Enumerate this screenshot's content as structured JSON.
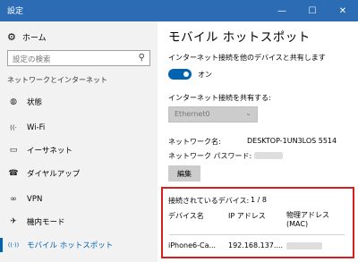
{
  "window": {
    "title": "設定",
    "controls": [
      "—",
      "☐",
      "✕"
    ]
  },
  "sidebar": {
    "home_label": "ホーム",
    "search_placeholder": "設定の検索",
    "section_title": "ネットワークとインターネット",
    "items": [
      {
        "label": "状態",
        "icon": "globe-icon",
        "glyph": "◍"
      },
      {
        "label": "Wi-Fi",
        "icon": "wifi-icon",
        "glyph": "((·"
      },
      {
        "label": "イーサネット",
        "icon": "ethernet-icon",
        "glyph": "▭"
      },
      {
        "label": "ダイヤルアップ",
        "icon": "dialup-icon",
        "glyph": "☎"
      },
      {
        "label": "VPN",
        "icon": "vpn-icon",
        "glyph": "∞"
      },
      {
        "label": "機内モード",
        "icon": "airplane-icon",
        "glyph": "✈"
      },
      {
        "label": "モバイル ホットスポット",
        "icon": "hotspot-icon",
        "glyph": "((·))"
      }
    ],
    "active_index": 6
  },
  "main": {
    "title": "モバイル ホットスポット",
    "share_label": "インターネット接続を他のデバイスと共有します",
    "toggle_state": "オン",
    "share_from_label": "インターネット接続を共有する:",
    "share_from_value": "Ethernet0",
    "network_name_label": "ネットワーク名:",
    "network_name_value": "DESKTOP-1UN3LOS 5514",
    "password_label": "ネットワーク パスワード:",
    "edit_button": "編集",
    "connected_label": "接続されているデバイス:",
    "connected_count": "1 / 8",
    "table": {
      "headers": [
        "デバイス名",
        "IP アドレス",
        "物理アドレス\n(MAC)"
      ],
      "rows": [
        [
          "iPhone6-Ca...",
          "192.168.137...."
        ]
      ]
    }
  },
  "colors": {
    "accent": "#0063b1",
    "titlebar": "#2b6cb5",
    "highlight_box": "#d6201e"
  }
}
